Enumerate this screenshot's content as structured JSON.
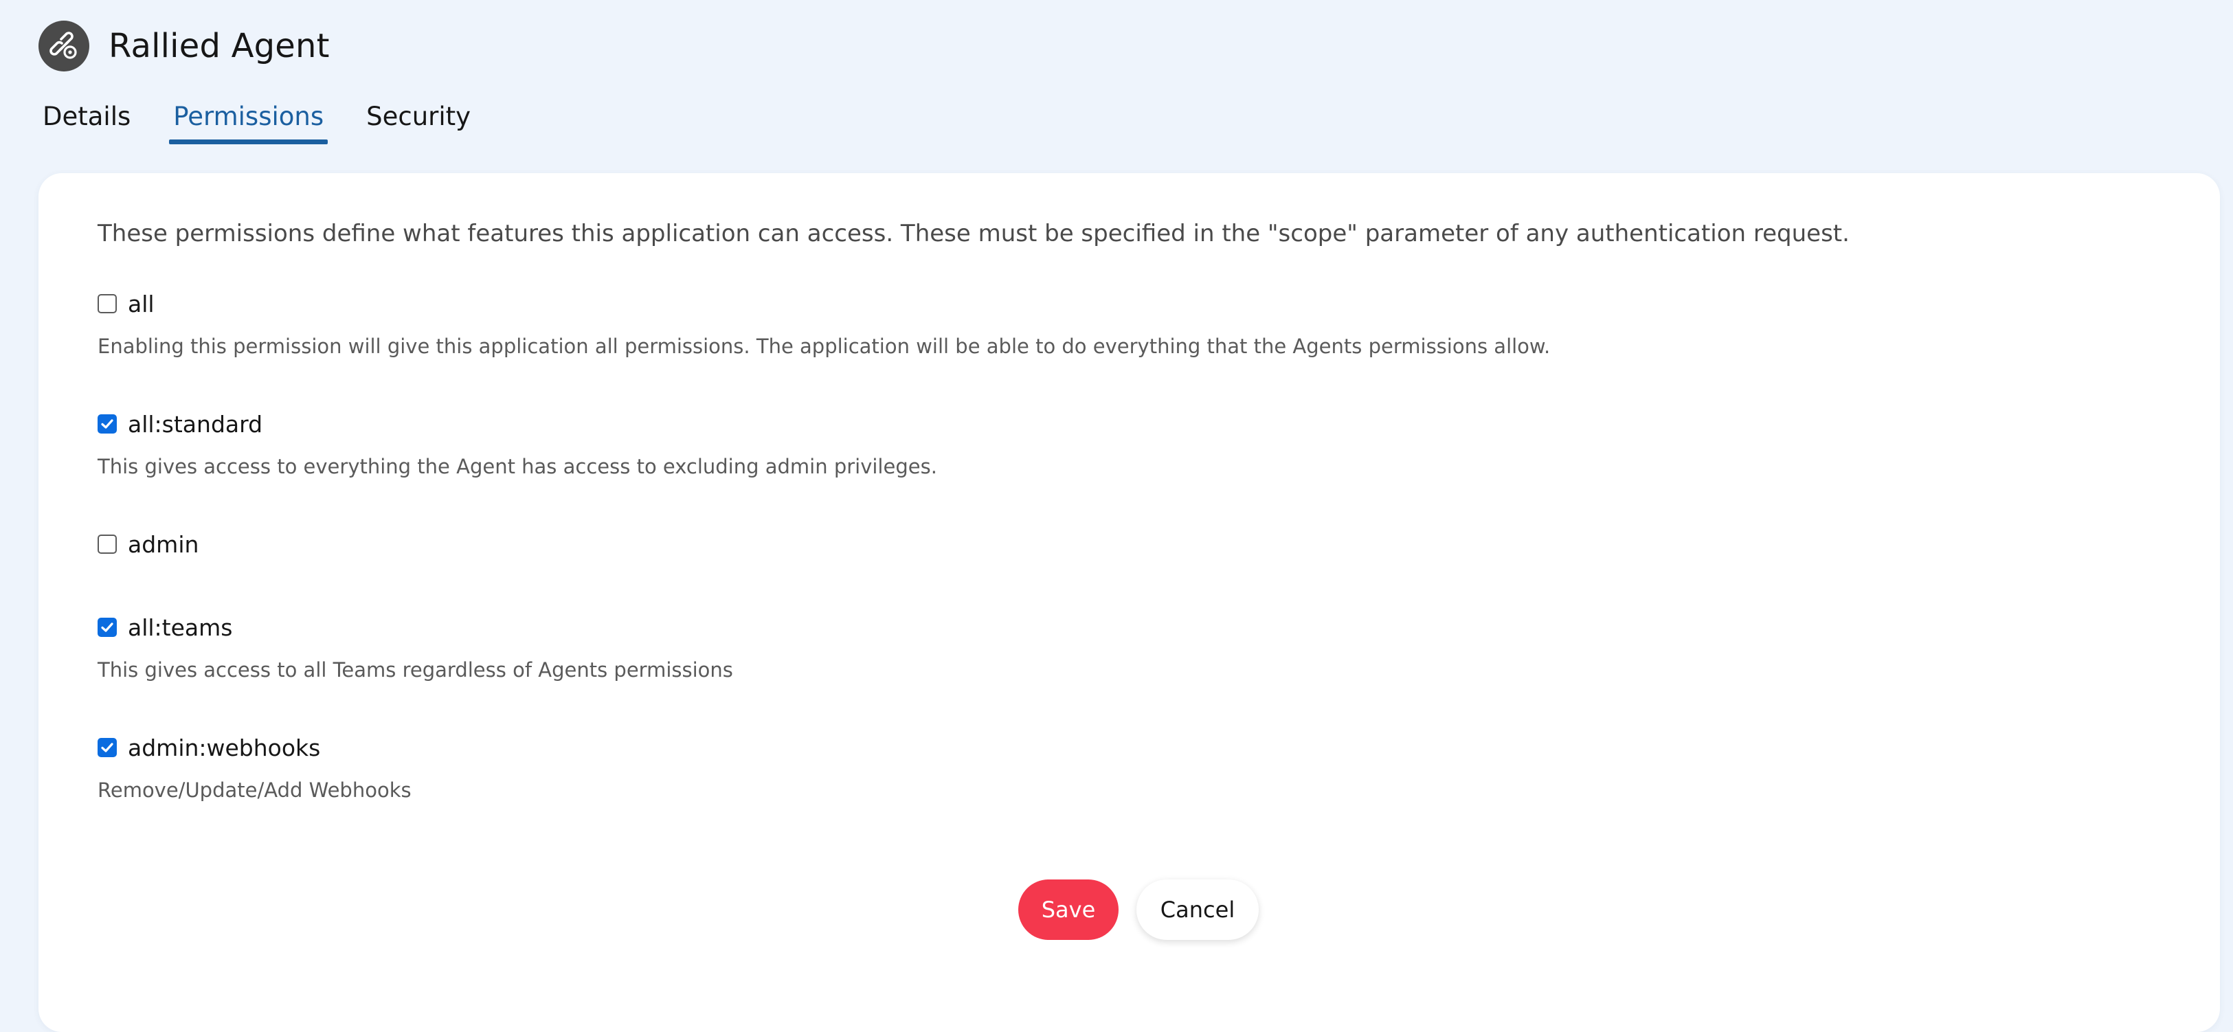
{
  "app": {
    "title": "Rallied Agent",
    "icon": "link-gear-icon"
  },
  "tabs": [
    {
      "label": "Details",
      "active": false
    },
    {
      "label": "Permissions",
      "active": true
    },
    {
      "label": "Security",
      "active": false
    }
  ],
  "permissions": {
    "intro": "These permissions define what features this application can access. These must be specified in the \"scope\" parameter of any authentication request.",
    "items": [
      {
        "name": "all",
        "checked": false,
        "description": "Enabling this permission will give this application all permissions. The application will be able to do everything that the Agents permissions allow."
      },
      {
        "name": "all:standard",
        "checked": true,
        "description": "This gives access to everything the Agent has access to excluding admin privileges."
      },
      {
        "name": "admin",
        "checked": false,
        "description": ""
      },
      {
        "name": "all:teams",
        "checked": true,
        "description": "This gives access to all Teams regardless of Agents permissions"
      },
      {
        "name": "admin:webhooks",
        "checked": true,
        "description": "Remove/Update/Add Webhooks"
      }
    ]
  },
  "actions": {
    "save_label": "Save",
    "cancel_label": "Cancel"
  },
  "colors": {
    "accent": "#1b5fa0",
    "checkbox_checked": "#0b6ce0",
    "save_button": "#f4384d",
    "background": "#eef4fc"
  }
}
